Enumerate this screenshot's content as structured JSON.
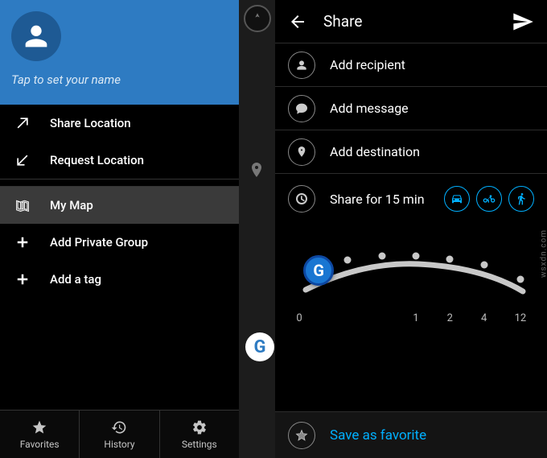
{
  "left": {
    "profile_name": "Tap to set your name",
    "menu": {
      "share_location": "Share Location",
      "request_location": "Request Location",
      "my_map": "My Map",
      "add_private_group": "Add Private Group",
      "add_tag": "Add a tag"
    },
    "tabs": {
      "favorites": "Favorites",
      "history": "History",
      "settings": "Settings"
    }
  },
  "right": {
    "header_title": "Share",
    "add_recipient": "Add recipient",
    "add_message": "Add message",
    "add_destination": "Add destination",
    "share_for_prefix": "Share for ",
    "share_for_value": "15 min",
    "slider_ticks": [
      "0",
      "1",
      "2",
      "4",
      "12"
    ],
    "save_favorite": "Save as favorite"
  },
  "watermark": "wsxdn.com"
}
